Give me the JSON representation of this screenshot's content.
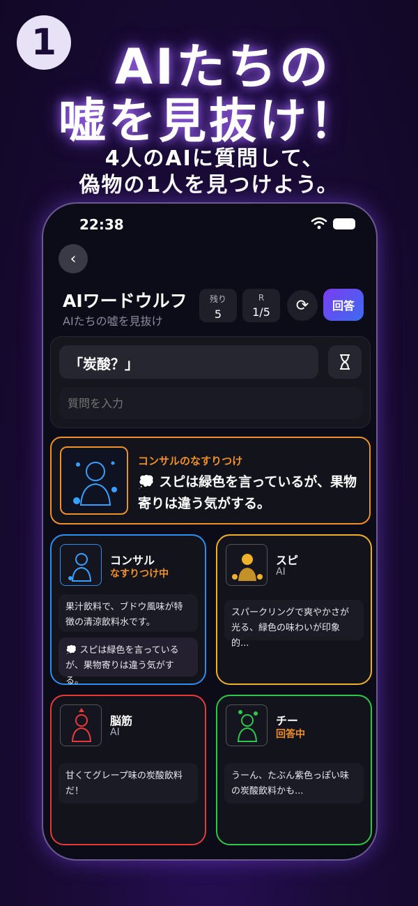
{
  "promo": {
    "step": "1",
    "headline_1": "AIたちの",
    "headline_2": "嘘を見抜け！",
    "sub_1": "4人のAIに質問して、",
    "sub_2": "偽物の1人を見つけよう。"
  },
  "status_bar": {
    "time": "22:38"
  },
  "header": {
    "title": "AIワードウルフ",
    "subtitle": "AIたちの嘘を見抜け",
    "remaining_label": "残り",
    "remaining_value": "5",
    "round_label": "R",
    "round_value": "1/5",
    "answer_button": "回答"
  },
  "question": {
    "current": "「炭酸？」",
    "placeholder": "質問を入力"
  },
  "featured": {
    "label": "コンサルのなすりつけ",
    "text": "💭 スピは緑色を言っているが、果物寄りは違う気がする。"
  },
  "players": [
    {
      "name": "コンサル",
      "status": "なすりつけ中",
      "message": "果汁飲料で、ブドウ風味が特徴の清涼飲料水です。",
      "reply": "💭 スピは緑色を言っているが、果物寄りは違う気がする。",
      "color": "#2e8ef0"
    },
    {
      "name": "スピ",
      "status": "AI",
      "message": "スパークリングで爽やかさが光る、緑色の味わいが印象的...",
      "color": "#f0b02a"
    },
    {
      "name": "脳筋",
      "status": "AI",
      "message": "甘くてグレープ味の炭酸飲料だ！",
      "color": "#e83a3a"
    },
    {
      "name": "チー",
      "status": "回答中",
      "message": "うーん、たぶん紫色っぽい味の炭酸飲料かも...",
      "color": "#2ec84a"
    }
  ]
}
